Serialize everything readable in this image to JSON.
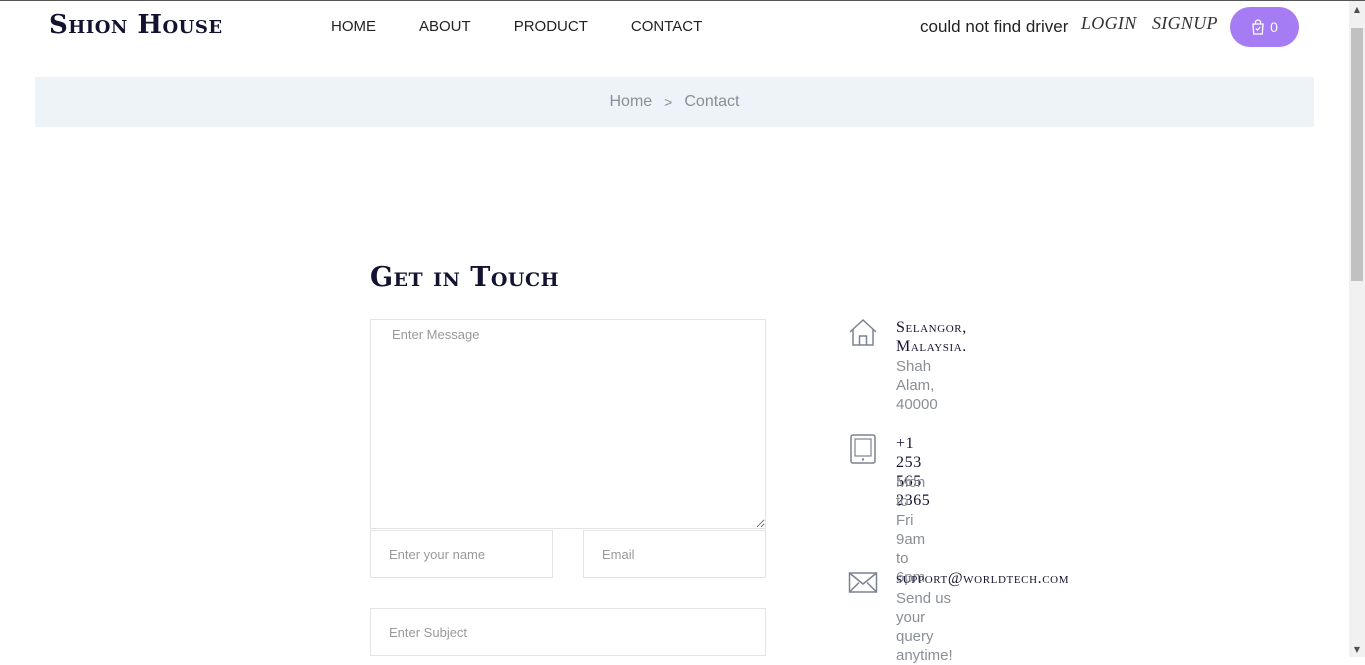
{
  "header": {
    "logo": "Shion House",
    "nav": [
      "HOME",
      "ABOUT",
      "PRODUCT",
      "CONTACT"
    ],
    "driver_message": "could not find driver",
    "login_label": "LOGIN",
    "signup_label": "SIGNUP",
    "cart_count": "0"
  },
  "breadcrumb": {
    "home": "Home",
    "separator": ">",
    "current": "Contact"
  },
  "contact": {
    "title": "Get in Touch",
    "message_placeholder": "Enter Message",
    "name_placeholder": "Enter your name",
    "email_placeholder": "Email",
    "subject_placeholder": "Enter Subject"
  },
  "info": {
    "address_title_1": "Selangor,",
    "address_title_2": "Malaysia.",
    "address_sub_1": "Shah Alam,",
    "address_sub_2": "40000",
    "phone_title_1": "+1 253 565",
    "phone_title_2": "2365",
    "phone_sub_1": "Mon to Fri",
    "phone_sub_2": "9am to",
    "phone_sub_3": "6pm",
    "email_title": "support@worldtech.com",
    "email_sub": "Send us your query anytime!"
  },
  "icons": {
    "home": "home-icon",
    "tablet": "tablet-icon",
    "mail": "mail-icon",
    "cart": "shopping-bag-icon",
    "chevron": "chevron-right-icon"
  },
  "colors": {
    "accent": "#a57cf3",
    "heading": "#131230",
    "muted": "#8a8f96",
    "breadcrumb_bg": "#eef3f8"
  }
}
